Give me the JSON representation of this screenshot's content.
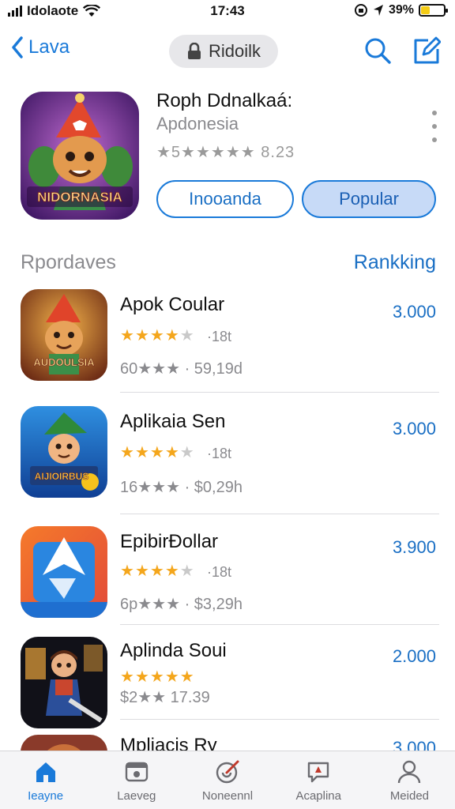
{
  "status_bar": {
    "carrier": "Idolaote",
    "time": "17:43",
    "battery": "39%",
    "battery_level": 0.39
  },
  "nav": {
    "back_label": "Lava",
    "title": "Ridoilk"
  },
  "featured": {
    "title": "Roph Ddnalkaá:",
    "subtitle": "Apdonesia",
    "rating_text": "★5★★★★★ 8.23",
    "icon_caption": "NIDORNASIA",
    "button_outline": "Inooanda",
    "button_filled": "Popular"
  },
  "section": {
    "title": "Rpordaves",
    "link": "Rankking"
  },
  "apps": [
    {
      "name": "Apok Coular",
      "stars": 4,
      "meta_a": "·18t",
      "meta_b": "60★★★ · 59,19d",
      "price": "3.000",
      "icon_caption": "AUDOULSIA"
    },
    {
      "name": "Aplikaia Sen",
      "stars": 4,
      "meta_a": "·18t",
      "meta_b": "16★★★ · $0,29h",
      "price": "3.000",
      "icon_caption": "AIJIOIRBUS"
    },
    {
      "name": "EpibirƉollar",
      "stars": 4,
      "meta_a": "·18t",
      "meta_b": "6p★★★ · $3,29h",
      "price": "3.900",
      "icon_caption": ""
    },
    {
      "name": "Aplinda Soui",
      "stars": 5,
      "meta_a": "",
      "meta_b": "$2★★ 17.39",
      "price": "2.000",
      "icon_caption": ""
    },
    {
      "name": "Mpliacis Ry",
      "stars": 0,
      "meta_a": "",
      "meta_b": "",
      "price": "3.000",
      "icon_caption": ""
    }
  ],
  "tabs": [
    {
      "label": "Ieayne",
      "icon": "home-icon",
      "active": true
    },
    {
      "label": "Laeveg",
      "icon": "media-icon",
      "active": false
    },
    {
      "label": "Noneennl",
      "icon": "compass-icon",
      "active": false
    },
    {
      "label": "Acaplina",
      "icon": "chat-icon",
      "active": false
    },
    {
      "label": "Meided",
      "icon": "person-icon",
      "active": false
    }
  ],
  "colors": {
    "accent": "#1a7ad9",
    "star": "#f4a61c",
    "secondary_text": "#8a8a8e"
  }
}
